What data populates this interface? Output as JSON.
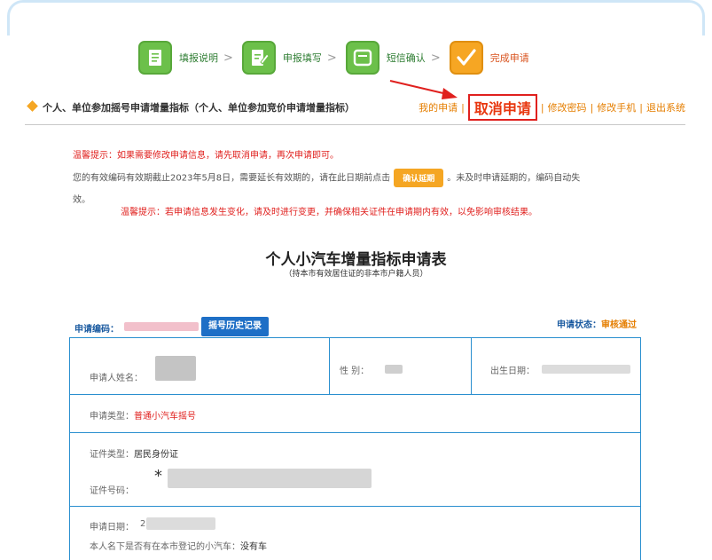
{
  "steps": [
    {
      "label": "填报说明",
      "icon": "document-icon",
      "state": "complete"
    },
    {
      "label": "申报填写",
      "icon": "edit-form-icon",
      "state": "complete"
    },
    {
      "label": "短信确认",
      "icon": "sms-icon",
      "state": "complete"
    },
    {
      "label": "完成申请",
      "icon": "checkmark-icon",
      "state": "current"
    }
  ],
  "step_separator": ">",
  "header": {
    "title": "个人、单位参加摇号申请增量指标（个人、单位参加竞价申请增量指标）",
    "links": {
      "my_application": "我的申请",
      "cancel_application": "取消申请",
      "change_password": "修改密码",
      "change_phone": "修改手机",
      "logout": "退出系统"
    },
    "separator": "|"
  },
  "notices": {
    "tip1": "温馨提示：如果需要修改申请信息，请先取消申请，再次申请即可。",
    "validity_prefix": "您的有效编码有效期截止2023年5月8日，需要延长有效期的，请在此日期前点击",
    "confirm_extend_button": "确认延期",
    "validity_suffix": "。未及时申请延期的，编码自动失",
    "validity_wrap": "效。",
    "tip2": "温馨提示：若申请信息发生变化，请及时进行变更，并确保相关证件在申请期内有效，以免影响审核结果。"
  },
  "form": {
    "title": "个人小汽车增量指标申请表",
    "subtitle": "（持本市有效居住证的非本市户籍人员）",
    "code_label": "申请编码：",
    "history_button": "摇号历史记录",
    "status_label": "申请状态：",
    "status_value": "审核通过",
    "name_label": "申请人姓名：",
    "gender_label": "性 别：",
    "dob_label": "出生日期：",
    "type_label": "申请类型：",
    "type_value": "普通小汽车摇号",
    "id_type_label": "证件类型：",
    "id_type_value": "居民身份证",
    "id_number_label": "证件号码：",
    "id_number_visible_prefix": "*",
    "apply_date_label": "申请日期：",
    "apply_date_visible_prefix": "2",
    "car_owned_label": "本人名下是否有在本市登记的小汽车：",
    "car_owned_value": "没有车"
  },
  "colors": {
    "accent_orange": "#e57e00",
    "alert_red": "#e0201e",
    "step_green": "#6cc04a",
    "step_done_orange": "#f6a623",
    "table_border_blue": "#2a8fcf",
    "button_blue": "#1e6fc6"
  }
}
